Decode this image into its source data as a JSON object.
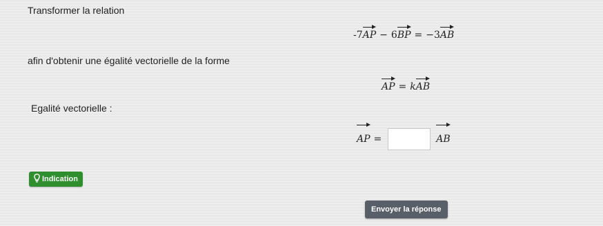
{
  "instruction": "Transformer la relation",
  "relation": {
    "term1_coef": "-7",
    "term1_vec": "AP",
    "op1": "−",
    "term2_coef": "6",
    "term2_vec": "BP",
    "equals": "=",
    "term3_coef": "−3",
    "term3_vec": "AB"
  },
  "form_intro": "afin d'obtenir une égalité vectorielle de la forme",
  "form": {
    "lhs_vec": "AP",
    "equals": "=",
    "coef": "k",
    "rhs_vec": "AB"
  },
  "egalite_label": "Egalité vectorielle :",
  "answer": {
    "lhs_vec": "AP",
    "equals": "=",
    "input_value": "",
    "rhs_vec": "AB"
  },
  "hint_button": {
    "label": "Indication",
    "icon": "lightbulb-icon"
  },
  "submit_button": {
    "label": "Envoyer la réponse"
  },
  "colors": {
    "hint_green": "#2f8f2f",
    "submit_gray": "#585f68"
  }
}
